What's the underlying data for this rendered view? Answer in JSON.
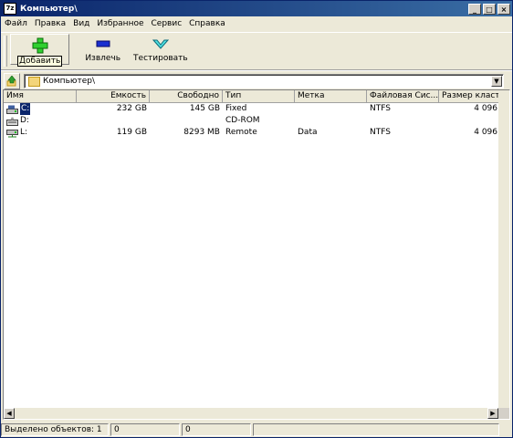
{
  "window": {
    "title": "Компьютер\\",
    "app_icon": "7z"
  },
  "menu": [
    "Файл",
    "Правка",
    "Вид",
    "Избранное",
    "Сервис",
    "Справка"
  ],
  "toolbar": {
    "add": {
      "label": "Добавить",
      "icon": "green-plus-icon"
    },
    "extract": {
      "label": "Извлечь",
      "icon": "blue-minus-icon"
    },
    "test": {
      "label": "Тестировать",
      "icon": "cyan-check-icon"
    }
  },
  "address": {
    "path": "Компьютер\\"
  },
  "columns": [
    "Имя",
    "Емкость",
    "Свободно",
    "Тип",
    "Метка",
    "Файловая Сис...",
    "Размер кластера"
  ],
  "rows": [
    {
      "name": "C:",
      "capacity": "232 GB",
      "free": "145 GB",
      "type": "Fixed",
      "label": "",
      "fs": "NTFS",
      "cluster": "4 096",
      "icon": "hard-drive-icon"
    },
    {
      "name": "D:",
      "capacity": "",
      "free": "",
      "type": "CD-ROM",
      "label": "",
      "fs": "",
      "cluster": "",
      "icon": "cdrom-drive-icon"
    },
    {
      "name": "L:",
      "capacity": "119 GB",
      "free": "8293 MB",
      "type": "Remote",
      "label": "Data",
      "fs": "NTFS",
      "cluster": "4 096",
      "icon": "network-drive-icon"
    }
  ],
  "status": {
    "selected": "Выделено объектов: 1",
    "size": "0",
    "packed": "0",
    "extra": ""
  },
  "colors": {
    "titlebar_start": "#0a246a",
    "titlebar_end": "#3a6ea5",
    "selection": "#0a246a",
    "face": "#ece9d8"
  }
}
